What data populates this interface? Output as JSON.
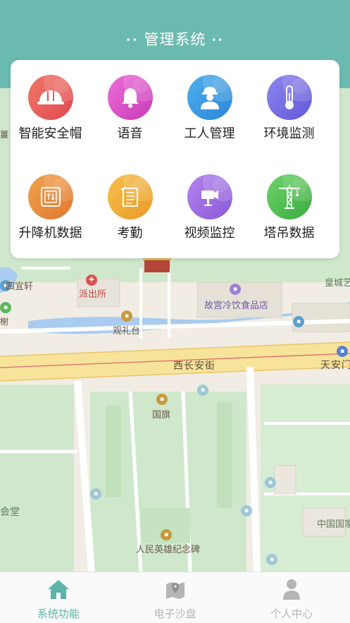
{
  "header": {
    "title": "管理系统",
    "dots_left": "••",
    "dots_right": "••",
    "bg_color": "#6bbab0"
  },
  "functions": [
    {
      "label": "智能安全帽",
      "icon": "helmet-icon",
      "color_a": "#f0796a",
      "color_b": "#e0494e"
    },
    {
      "label": "语音",
      "icon": "bell-icon",
      "color_a": "#ec6fd8",
      "color_b": "#c93ab7"
    },
    {
      "label": "工人管理",
      "icon": "worker-icon",
      "color_a": "#4fb1ec",
      "color_b": "#2b86d8"
    },
    {
      "label": "环境监测",
      "icon": "thermometer-icon",
      "color_a": "#8e86ef",
      "color_b": "#6259d8"
    },
    {
      "label": "升降机数据",
      "icon": "elevator-icon",
      "color_a": "#f2a24c",
      "color_b": "#e07830"
    },
    {
      "label": "考勤",
      "icon": "attendance-icon",
      "color_a": "#f6bf4e",
      "color_b": "#eb9a26"
    },
    {
      "label": "视频监控",
      "icon": "camera-icon",
      "color_a": "#b385ee",
      "color_b": "#8c59d8"
    },
    {
      "label": "塔吊数据",
      "icon": "tower-crane-icon",
      "color_a": "#6ed36a",
      "color_b": "#3aab3e"
    }
  ],
  "map": {
    "labels": {
      "wu": "四宜轩",
      "police": "派出所",
      "guanlitai": "观礼台",
      "gugong_food": "故宫冷饮食品店",
      "huangcheng": "皇城艺",
      "changan": "西长安街",
      "tiananmen": "天安门",
      "guoqi": "国旗",
      "huitang": "会堂",
      "zhongguo": "中国国家",
      "monument": "人民英雄纪念碑",
      "left_edge": "薑",
      "left_edge2": "榭"
    }
  },
  "bottom_nav": [
    {
      "label": "系统功能",
      "icon": "home-icon",
      "active": true
    },
    {
      "label": "电子沙盘",
      "icon": "map-pin-icon",
      "active": false
    },
    {
      "label": "个人中心",
      "icon": "user-icon",
      "active": false
    }
  ],
  "colors": {
    "accent": "#5bb3aa",
    "inactive": "#b5b5b5"
  }
}
